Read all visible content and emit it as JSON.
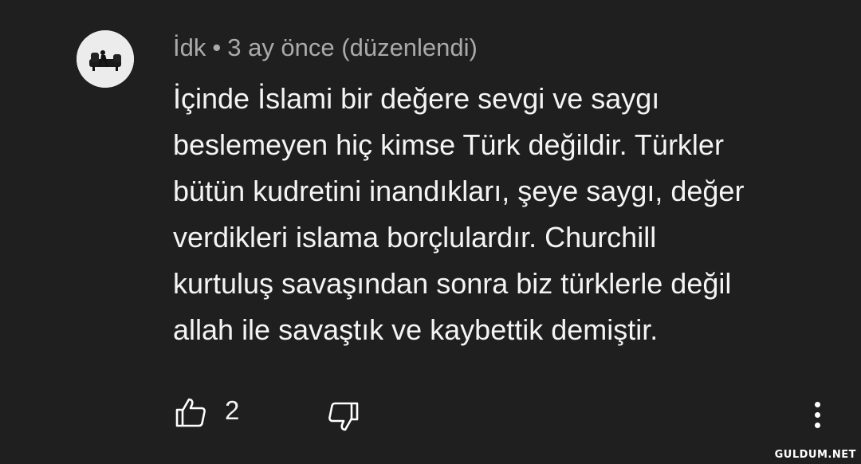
{
  "comment": {
    "author": "İdk",
    "separator": "•",
    "timestamp": "3 ay önce (düzenlendi)",
    "text": "İçinde İslami bir değere sevgi ve saygı\nbeslemeyen hiç kimse Türk değildir. Türkler\nbütün kudretini inandıkları, şeye saygı, değer\nverdikleri islama borçlulardır. Churchill\nkurtuluş savaşından sonra biz türklerle değil\nallah ile savaştık ve kaybettik demiştir.",
    "avatar_icon": "profile-photo",
    "actions": {
      "like_icon": "thumbs-up-outline-icon",
      "like_count": "2",
      "dislike_icon": "thumbs-down-outline-icon",
      "more_icon": "vertical-ellipsis-icon"
    }
  },
  "watermark": "GULDUM.NET",
  "colors": {
    "background": "#1f1f1f",
    "meta_text": "#aaaaaa",
    "body_text": "#f4f4f4"
  }
}
